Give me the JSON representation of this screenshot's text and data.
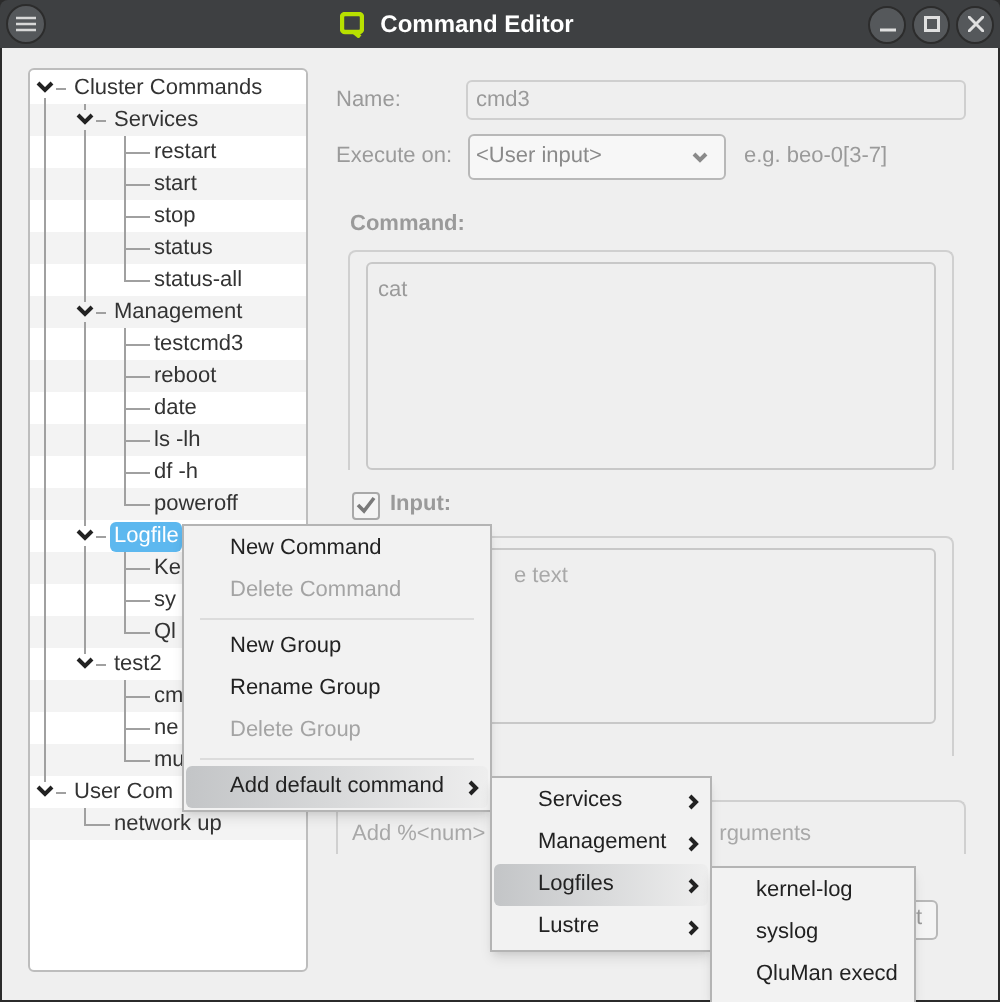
{
  "window": {
    "title": "Command Editor"
  },
  "tree": {
    "items": [
      {
        "label": "Cluster Commands",
        "expanded": true,
        "selected": false,
        "children": [
          {
            "label": "Services",
            "expanded": true,
            "selected": false,
            "children": [
              {
                "label": "restart",
                "selected": false
              },
              {
                "label": "start",
                "selected": false
              },
              {
                "label": "stop",
                "selected": false
              },
              {
                "label": "status",
                "selected": false
              },
              {
                "label": "status-all",
                "selected": false
              }
            ]
          },
          {
            "label": "Management",
            "expanded": true,
            "selected": false,
            "children": [
              {
                "label": "testcmd3",
                "selected": false
              },
              {
                "label": "reboot",
                "selected": false
              },
              {
                "label": "date",
                "selected": false
              },
              {
                "label": "ls -lh",
                "selected": false
              },
              {
                "label": "df -h",
                "selected": false
              },
              {
                "label": "poweroff",
                "selected": false
              }
            ]
          },
          {
            "label": "Logfile",
            "expanded": true,
            "selected": true,
            "children": [
              {
                "label": "Ke",
                "selected": false
              },
              {
                "label": "sy",
                "selected": false
              },
              {
                "label": "Ql",
                "selected": false
              }
            ]
          },
          {
            "label": "test2",
            "expanded": true,
            "selected": false,
            "children": [
              {
                "label": "cm",
                "selected": false
              },
              {
                "label": "ne",
                "selected": false
              },
              {
                "label": "mu",
                "selected": false
              }
            ]
          }
        ]
      },
      {
        "label": "User Com",
        "expanded": true,
        "selected": false,
        "children": [
          {
            "label": "network up",
            "selected": false
          }
        ]
      }
    ]
  },
  "form": {
    "name_label": "Name:",
    "name_value": "cmd3",
    "execute_label": "Execute on:",
    "execute_value": "<User input>",
    "execute_hint": "e.g. beo-0[3-7]",
    "command_label": "Command:",
    "command_text": "cat",
    "input_label": "Input:",
    "input_checked": true,
    "input_placeholder": "e text",
    "arguments_placeholder_start": "Add %<num>",
    "arguments_placeholder_end": "rguments",
    "button_text": "t"
  },
  "context_menu": {
    "items": [
      {
        "kind": "item",
        "label": "New Command",
        "disabled": false,
        "highlighted": false,
        "submenu": false
      },
      {
        "kind": "item",
        "label": "Delete Command",
        "disabled": true,
        "highlighted": false,
        "submenu": false
      },
      {
        "kind": "separator"
      },
      {
        "kind": "item",
        "label": "New Group",
        "disabled": false,
        "highlighted": false,
        "submenu": false
      },
      {
        "kind": "item",
        "label": "Rename Group",
        "disabled": false,
        "highlighted": false,
        "submenu": false
      },
      {
        "kind": "item",
        "label": "Delete Group",
        "disabled": true,
        "highlighted": false,
        "submenu": false
      },
      {
        "kind": "separator"
      },
      {
        "kind": "item",
        "label": "Add default command",
        "disabled": false,
        "highlighted": true,
        "submenu": true
      }
    ]
  },
  "submenu": {
    "items": [
      {
        "kind": "item",
        "label": "Services",
        "disabled": false,
        "highlighted": false,
        "submenu": true
      },
      {
        "kind": "item",
        "label": "Management",
        "disabled": false,
        "highlighted": false,
        "submenu": true
      },
      {
        "kind": "item",
        "label": "Logfiles",
        "disabled": false,
        "highlighted": true,
        "submenu": true
      },
      {
        "kind": "item",
        "label": "Lustre",
        "disabled": false,
        "highlighted": false,
        "submenu": true
      }
    ]
  },
  "submenu_2": {
    "items": [
      {
        "kind": "item",
        "label": "kernel-log",
        "disabled": false,
        "highlighted": false,
        "submenu": false
      },
      {
        "kind": "item",
        "label": "syslog",
        "disabled": false,
        "highlighted": false,
        "submenu": false
      },
      {
        "kind": "item",
        "label": "QluMan execd",
        "disabled": false,
        "highlighted": false,
        "submenu": false
      }
    ]
  }
}
